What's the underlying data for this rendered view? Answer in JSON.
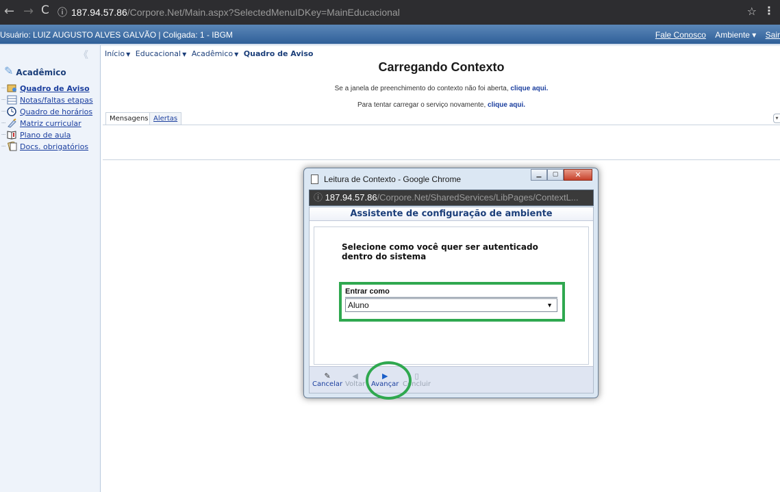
{
  "browser": {
    "back": "←",
    "forward": "→",
    "reload": "C",
    "info": "ⓘ",
    "url_host": "187.94.57.86",
    "url_path": "/Corpore.Net/Main.aspx?SelectedMenuIDKey=MainEducacional",
    "star": "☆",
    "menu": "⋮"
  },
  "user_bar": {
    "info": "Usuário: LUIZ AUGUSTO ALVES GALVÃO  |  Coligada: 1 - IBGM",
    "contact": "Fale Conosco",
    "environment": "Ambiente ▾",
    "exit": "Sair"
  },
  "sidebar": {
    "collapse": "《",
    "heading": "Acadêmico",
    "items": [
      {
        "label": "Quadro de Aviso",
        "icon": "notice-board-icon"
      },
      {
        "label": "Notas/faltas etapas",
        "icon": "grades-table-icon"
      },
      {
        "label": "Quadro de horários",
        "icon": "clock-icon"
      },
      {
        "label": "Matriz curricular",
        "icon": "curriculum-icon"
      },
      {
        "label": "Plano de aula",
        "icon": "lesson-plan-icon"
      },
      {
        "label": "Docs. obrigatórios",
        "icon": "documents-icon"
      }
    ]
  },
  "breadcrumb": {
    "home": "Início",
    "edu": "Educacional",
    "acad": "Acadêmico",
    "current": "Quadro de Aviso"
  },
  "main": {
    "title": "Carregando Contexto",
    "line1_text": "Se a janela de preenchimento do contexto não foi aberta,",
    "line1_link": "clique aqui.",
    "line2_text": "Para tentar carregar o serviço novamente,",
    "line2_link": "clique aqui.",
    "tabs": [
      "Mensagens",
      "Alertas"
    ]
  },
  "popup": {
    "title": "Leitura de Contexto - Google Chrome",
    "url_info": "ⓘ",
    "url_host": "187.94.57.86",
    "url_path": "/Corpore.Net/SharedServices/LibPages/ContextL...",
    "wizard_title": "Assistente de configuração de ambiente",
    "prompt": "Selecione como você quer ser autenticado dentro do sistema",
    "field_label": "Entrar como",
    "field_value": "Aluno",
    "buttons": {
      "cancel": "Cancelar",
      "back": "Voltar",
      "next": "Avançar",
      "finish": "Concluir"
    }
  },
  "colors": {
    "header_blue": "#2f5f98",
    "highlight_green": "#2fa84f",
    "link_blue": "#1a3e9e"
  }
}
